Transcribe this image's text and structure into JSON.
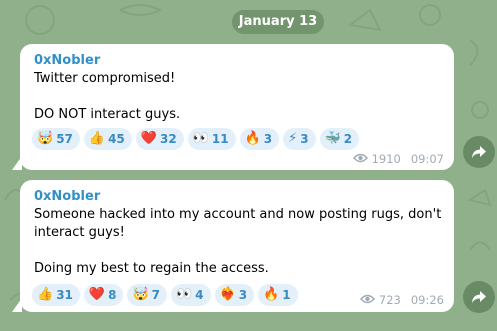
{
  "date_label": "January 13",
  "messages": [
    {
      "sender": "0xNobler",
      "text": "Twitter compromised!\n\nDO NOT interact guys.",
      "reactions": [
        {
          "emoji": "🤯",
          "count": "57",
          "icon": "exploding-head"
        },
        {
          "emoji": "👍",
          "count": "45",
          "icon": "thumbs-up"
        },
        {
          "emoji": "❤️",
          "count": "32",
          "icon": "red-heart"
        },
        {
          "emoji": "👀",
          "count": "11",
          "icon": "eyes"
        },
        {
          "emoji": "🔥",
          "count": "3",
          "icon": "fire"
        },
        {
          "emoji": "⚡",
          "count": "3",
          "icon": "lightning"
        },
        {
          "emoji": "🐳",
          "count": "2",
          "icon": "whale"
        }
      ],
      "views": "1910",
      "time": "09:07"
    },
    {
      "sender": "0xNobler",
      "text": "Someone hacked into my account and now posting rugs, don't interact guys!\n\nDoing my best to regain the access.",
      "reactions": [
        {
          "emoji": "👍",
          "count": "31",
          "icon": "thumbs-up"
        },
        {
          "emoji": "❤️",
          "count": "8",
          "icon": "red-heart"
        },
        {
          "emoji": "🤯",
          "count": "7",
          "icon": "exploding-head"
        },
        {
          "emoji": "👀",
          "count": "4",
          "icon": "eyes"
        },
        {
          "emoji": "❤️‍🔥",
          "count": "3",
          "icon": "heart-on-fire"
        },
        {
          "emoji": "🔥",
          "count": "1",
          "icon": "fire"
        }
      ],
      "views": "723",
      "time": "09:26"
    }
  ],
  "colors": {
    "background": "#8fb08a",
    "sender": "#3390c7",
    "reaction_bg": "#e3f0fa",
    "reaction_text": "#3a8bc4",
    "meta": "#a1aab3"
  }
}
